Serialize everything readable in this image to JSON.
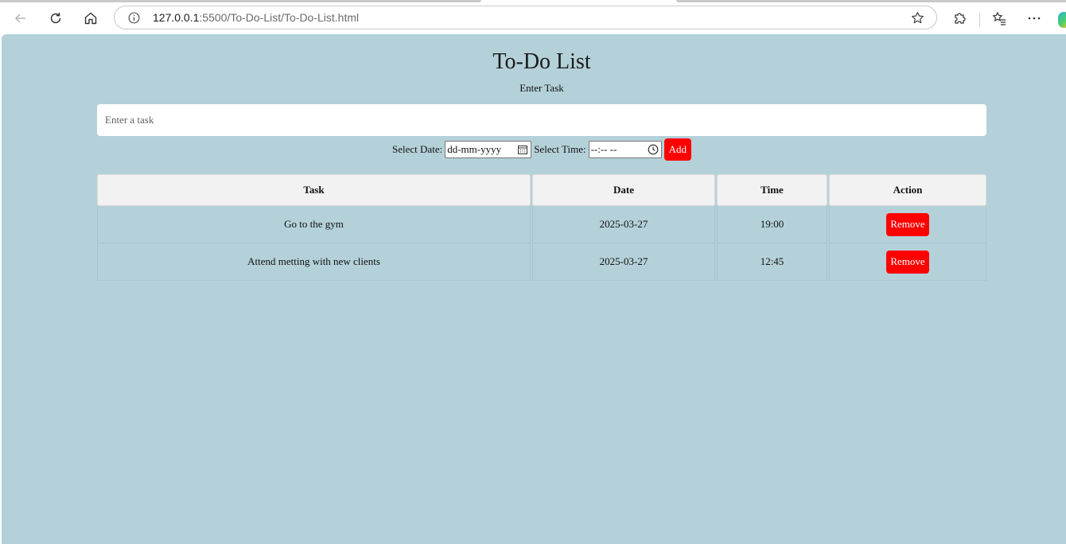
{
  "browser": {
    "url_host": "127.0.0.1",
    "url_rest": ":5500/To-Do-List/To-Do-List.html"
  },
  "app": {
    "title": "To-Do List",
    "enter_label": "Enter Task",
    "task_placeholder": "Enter a task",
    "date_label": "Select Date:",
    "date_value": "dd-mm-yyyy",
    "time_label": "Select Time:",
    "time_value": "--:-- --",
    "add_label": "Add"
  },
  "table": {
    "headers": [
      "Task",
      "Date",
      "Time",
      "Action"
    ],
    "rows": [
      {
        "task": "Go to the gym",
        "date": "2025-03-27",
        "time": "19:00",
        "action": "Remove"
      },
      {
        "task": "Attend metting with new clients",
        "date": "2025-03-27",
        "time": "12:45",
        "action": "Remove"
      }
    ]
  },
  "colors": {
    "page_background": "#b4d1d9",
    "accent_red": "#ff0000"
  }
}
